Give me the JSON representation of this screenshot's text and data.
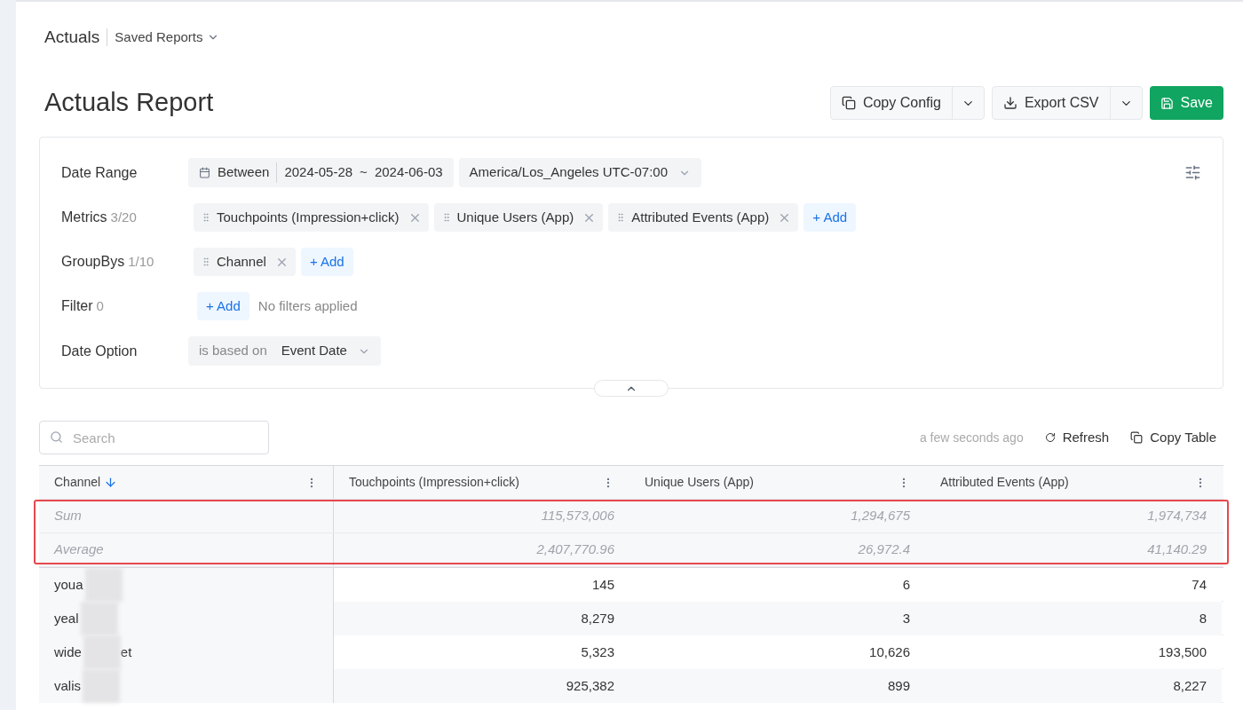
{
  "breadcrumb": {
    "title": "Actuals",
    "menu": "Saved Reports"
  },
  "page_title": "Actuals Report",
  "actions": [
    {
      "kind": "copy",
      "label": "Copy Config"
    },
    {
      "kind": "export",
      "label": "Export CSV"
    },
    {
      "kind": "save",
      "label": "Save"
    }
  ],
  "config": {
    "date_range": {
      "label": "Date Range",
      "mode": "Between",
      "start": "2024-05-28",
      "separator": "~",
      "end": "2024-06-03",
      "timezone": "America/Los_Angeles UTC-07:00"
    },
    "metrics": {
      "label": "Metrics",
      "count": "3/20",
      "items": [
        "Touchpoints (Impression+click)",
        "Unique Users (App)",
        "Attributed Events (App)"
      ],
      "add": "+ Add"
    },
    "groupbys": {
      "label": "GroupBys",
      "count": "1/10",
      "items": [
        "Channel"
      ],
      "add": "+ Add"
    },
    "filter": {
      "label": "Filter",
      "count": "0",
      "add": "+ Add",
      "empty": "No filters applied"
    },
    "date_option": {
      "label": "Date Option",
      "prefix": "is based on",
      "value": "Event Date"
    },
    "expanded": true
  },
  "search": {
    "placeholder": "Search"
  },
  "toolbar": {
    "updated": "a few seconds ago",
    "refresh": "Refresh",
    "copy": "Copy Table"
  },
  "table": {
    "columns": [
      {
        "label": "Channel",
        "sorted": true
      },
      {
        "label": "Touchpoints (Impression+click)",
        "sorted": false
      },
      {
        "label": "Unique Users (App)",
        "sorted": false
      },
      {
        "label": "Attributed Events (App)",
        "sorted": false
      }
    ],
    "summary_highlighted": true,
    "summary": [
      {
        "label": "Sum",
        "values": [
          "115,573,006",
          "1,294,675",
          "1,974,734"
        ]
      },
      {
        "label": "Average",
        "values": [
          "2,407,770.96",
          "26,972.4",
          "41,140.29"
        ]
      }
    ],
    "rows": [
      {
        "channel": "youa",
        "values": [
          "145",
          "6",
          "74"
        ]
      },
      {
        "channel": "yeal",
        "values": [
          "8,279",
          "3",
          "8"
        ]
      },
      {
        "channel": "wide",
        "channel_end": "et",
        "values": [
          "5,323",
          "10,626",
          "193,500"
        ]
      },
      {
        "channel": "valis",
        "values": [
          "925,382",
          "899",
          "8,227"
        ]
      }
    ]
  }
}
